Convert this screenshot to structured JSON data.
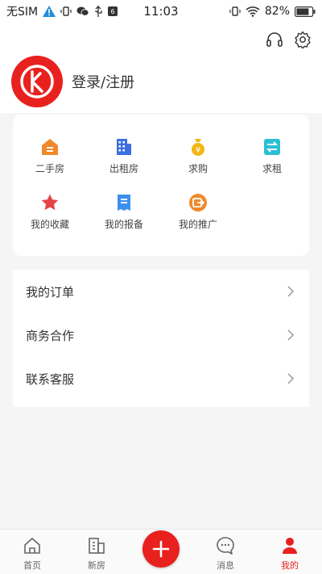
{
  "status_bar": {
    "carrier": "无SIM",
    "time": "11:03",
    "battery": "82%"
  },
  "profile": {
    "login_label": "登录/注册"
  },
  "quick_grid": [
    {
      "label": "二手房",
      "icon": "house-icon",
      "color": "#f0892c"
    },
    {
      "label": "出租房",
      "icon": "building-icon",
      "color": "#3d6fe0"
    },
    {
      "label": "求购",
      "icon": "money-bag-icon",
      "color": "#f4b617"
    },
    {
      "label": "求租",
      "icon": "swap-icon",
      "color": "#2bbfd6"
    },
    {
      "label": "我的收藏",
      "icon": "star-icon",
      "color": "#e64545"
    },
    {
      "label": "我的报备",
      "icon": "document-icon",
      "color": "#3d8ff0"
    },
    {
      "label": "我的推广",
      "icon": "share-icon",
      "color": "#f0892c"
    }
  ],
  "menu_list": [
    {
      "label": "我的订单"
    },
    {
      "label": "商务合作"
    },
    {
      "label": "联系客服"
    }
  ],
  "tabs": [
    {
      "label": "首页",
      "icon": "home-icon",
      "active": false
    },
    {
      "label": "新房",
      "icon": "building-outline-icon",
      "active": false
    },
    {
      "label": "消息",
      "icon": "chat-icon",
      "active": false
    },
    {
      "label": "我的",
      "icon": "person-icon",
      "active": true
    }
  ],
  "colors": {
    "brand_red": "#e8211e",
    "background": "#f5f5f5"
  }
}
